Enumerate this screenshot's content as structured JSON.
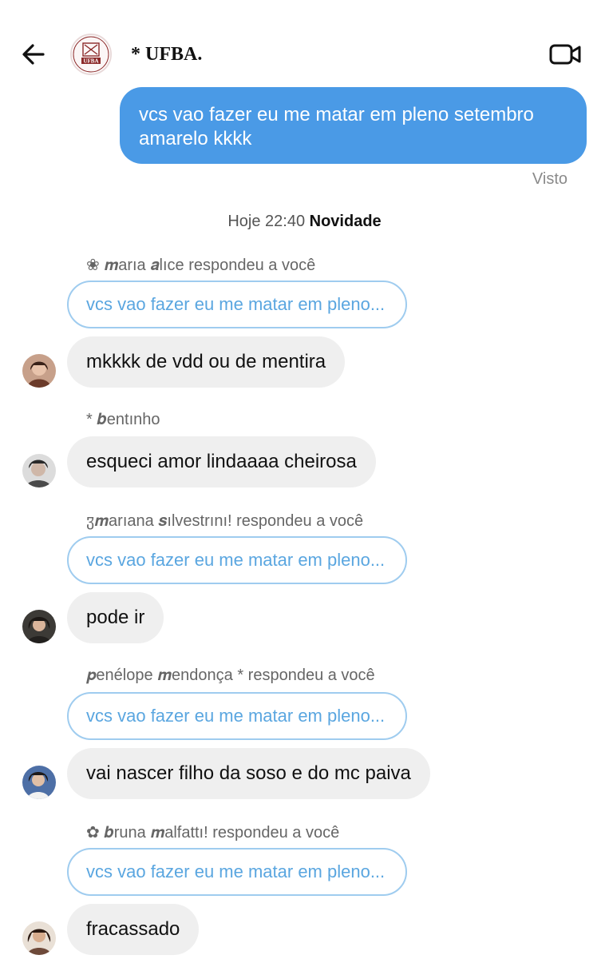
{
  "header": {
    "title": "* UFBA.",
    "avatar_text": "UFBA",
    "back_icon": "arrow-left-icon",
    "video_icon": "video-camera-icon"
  },
  "sent_message": {
    "text": "vcs vao fazer eu me matar em pleno setembro amarelo kkkk",
    "status": "Visto",
    "color": "#4a9ae6"
  },
  "divider": {
    "time": "Hoje 22:40",
    "label": "Novidade"
  },
  "messages": [
    {
      "reply_label": "❀ 𝒎arıa 𝒂lıce respondeu a você",
      "quote": "vcs vao fazer eu me matar em pleno...",
      "text": "mkkkk de vdd ou de mentira"
    },
    {
      "reply_label": "* 𝒃entınho",
      "text": "esqueci amor lindaaaa cheirosa"
    },
    {
      "reply_label": "ჳ𝒎arıana 𝒔ılvestrını! respondeu a você",
      "quote": "vcs vao fazer eu me matar em pleno...",
      "text": "pode ir"
    },
    {
      "reply_label": "𝒑enélope 𝒎endonça * respondeu a você",
      "quote": "vcs vao fazer eu me matar em pleno...",
      "text": "vai nascer filho da soso e do mc paiva"
    },
    {
      "reply_label": "✿ 𝒃runa 𝒎alfattı! respondeu a você",
      "quote": "vcs vao fazer eu me matar em pleno...",
      "text": "fracassado"
    }
  ]
}
